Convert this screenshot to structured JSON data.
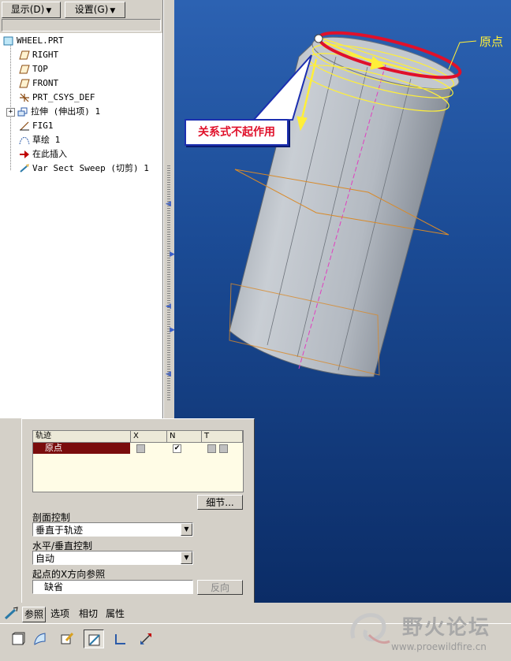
{
  "toolbar": {
    "display_menu": "显示(D)",
    "settings_menu": "设置(G)"
  },
  "tree": {
    "items": [
      {
        "label": "WHEEL.PRT",
        "icon": "part-icon"
      },
      {
        "label": "RIGHT",
        "icon": "datum-plane-icon"
      },
      {
        "label": "TOP",
        "icon": "datum-plane-icon"
      },
      {
        "label": "FRONT",
        "icon": "datum-plane-icon"
      },
      {
        "label": "PRT_CSYS_DEF",
        "icon": "csys-icon"
      },
      {
        "label": "拉伸 (伸出项) 1",
        "icon": "extrude-icon"
      },
      {
        "label": "FIG1",
        "icon": "axis-icon"
      },
      {
        "label": "草绘 1",
        "icon": "sketch-icon"
      },
      {
        "label": "在此插入",
        "icon": "insert-arrow-icon"
      },
      {
        "label": "Var Sect Sweep (切剪) 1",
        "icon": "sweep-icon"
      }
    ]
  },
  "viewport": {
    "callout_text": "关系式不起作用",
    "origin_label": "原点"
  },
  "dashboard": {
    "table_headers": [
      "轨迹",
      "X",
      "N",
      "T"
    ],
    "trajectory_row": {
      "name": "原点",
      "x_checked": false,
      "n_checked": true,
      "t_checked": false
    },
    "details_button": "细节...",
    "section_control_label": "剖面控制",
    "section_control_value": "垂直于轨迹",
    "hv_control_label": "水平/垂直控制",
    "hv_control_value": "自动",
    "start_x_ref_label": "起点的X方向参照",
    "start_x_ref_value": "缺省",
    "flip_button": "反向"
  },
  "tabs": {
    "references": "参照",
    "options": "选项",
    "tangency": "相切",
    "properties": "属性"
  },
  "watermark": {
    "title": "野火论坛",
    "url": "www.proewildfire.cn"
  },
  "colors": {
    "viewport_top": "#2c62b2",
    "viewport_bottom": "#0b2c66",
    "selected_row": "#7a0c0c",
    "highlight_red": "#e0102a",
    "highlight_yellow": "#ffef38"
  }
}
